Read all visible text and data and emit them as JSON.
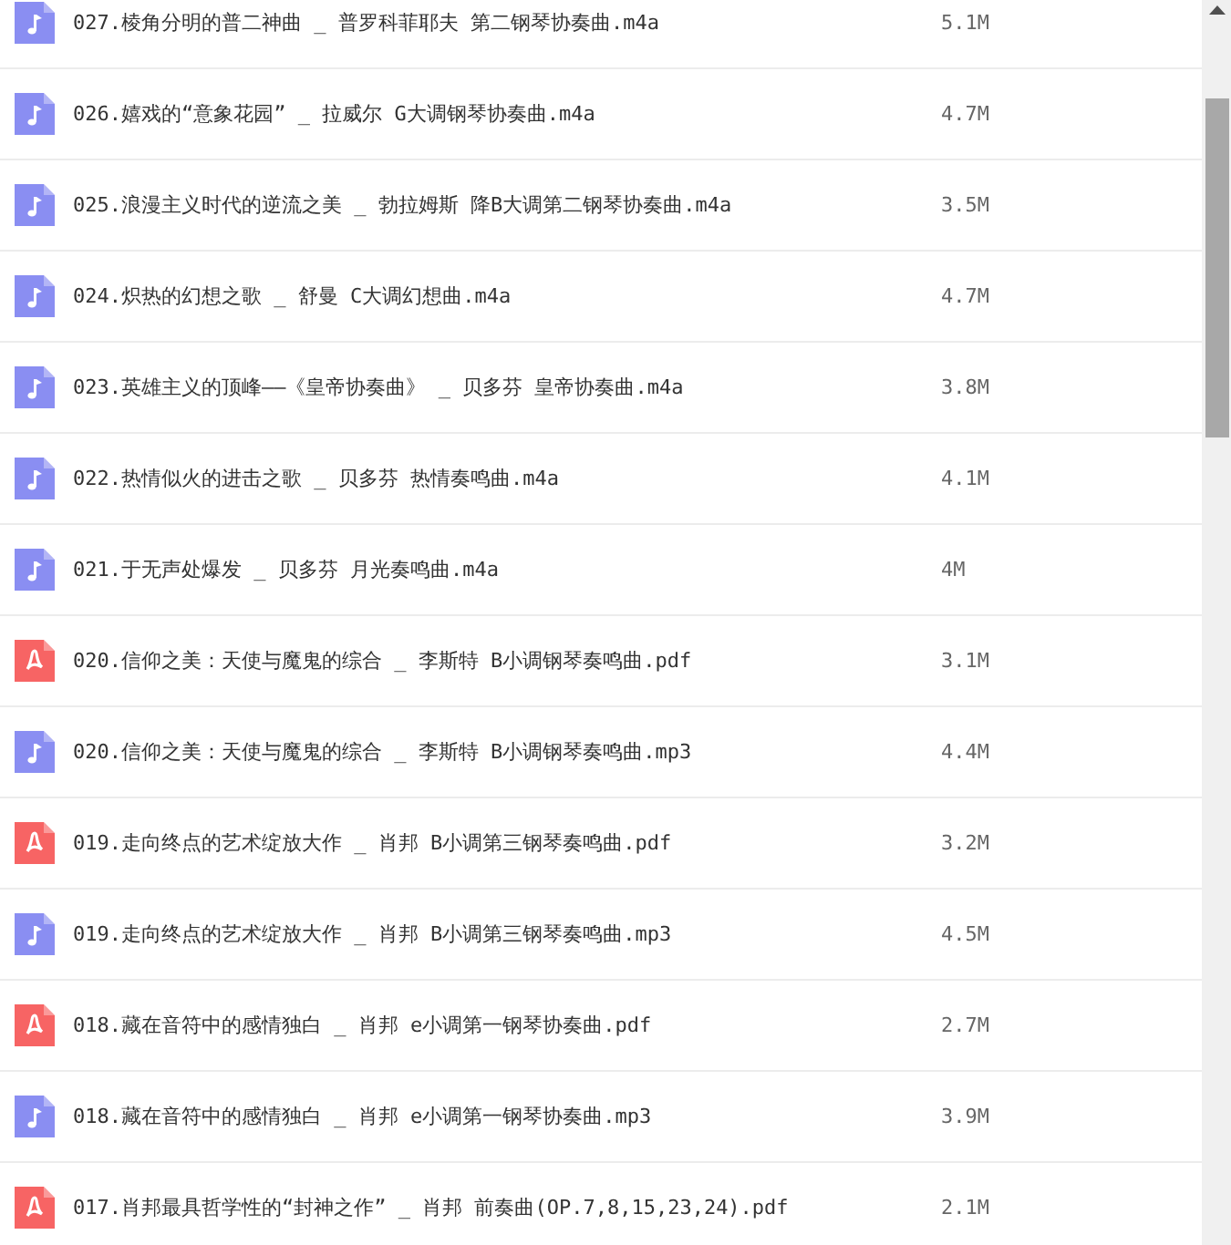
{
  "files": [
    {
      "kind": "audio",
      "name": "027.棱角分明的普二神曲 _ 普罗科菲耶夫 第二钢琴协奏曲.m4a",
      "size": "5.1M"
    },
    {
      "kind": "audio",
      "name": "026.嬉戏的“意象花园” _ 拉威尔 G大调钢琴协奏曲.m4a",
      "size": "4.7M"
    },
    {
      "kind": "audio",
      "name": "025.浪漫主义时代的逆流之美 _ 勃拉姆斯 降B大调第二钢琴协奏曲.m4a",
      "size": "3.5M"
    },
    {
      "kind": "audio",
      "name": "024.炽热的幻想之歌 _ 舒曼 C大调幻想曲.m4a",
      "size": "4.7M"
    },
    {
      "kind": "audio",
      "name": "023.英雄主义的顶峰——《皇帝协奏曲》 _ 贝多芬 皇帝协奏曲.m4a",
      "size": "3.8M"
    },
    {
      "kind": "audio",
      "name": "022.热情似火的进击之歌 _ 贝多芬 热情奏鸣曲.m4a",
      "size": "4.1M"
    },
    {
      "kind": "audio",
      "name": "021.于无声处爆发 _ 贝多芬 月光奏鸣曲.m4a",
      "size": "4M"
    },
    {
      "kind": "pdf",
      "name": "020.信仰之美：天使与魔鬼的综合 _ 李斯特 B小调钢琴奏鸣曲.pdf",
      "size": "3.1M"
    },
    {
      "kind": "audio",
      "name": "020.信仰之美：天使与魔鬼的综合 _ 李斯特 B小调钢琴奏鸣曲.mp3",
      "size": "4.4M"
    },
    {
      "kind": "pdf",
      "name": "019.走向终点的艺术绽放大作 _ 肖邦 B小调第三钢琴奏鸣曲.pdf",
      "size": "3.2M"
    },
    {
      "kind": "audio",
      "name": "019.走向终点的艺术绽放大作 _ 肖邦 B小调第三钢琴奏鸣曲.mp3",
      "size": "4.5M"
    },
    {
      "kind": "pdf",
      "name": "018.藏在音符中的感情独白 _ 肖邦 e小调第一钢琴协奏曲.pdf",
      "size": "2.7M"
    },
    {
      "kind": "audio",
      "name": "018.藏在音符中的感情独白 _ 肖邦 e小调第一钢琴协奏曲.mp3",
      "size": "3.9M"
    },
    {
      "kind": "pdf",
      "name": "017.肖邦最具哲学性的“封神之作” _ 肖邦 前奏曲(OP.7,8,15,23,24).pdf",
      "size": "2.1M"
    }
  ]
}
